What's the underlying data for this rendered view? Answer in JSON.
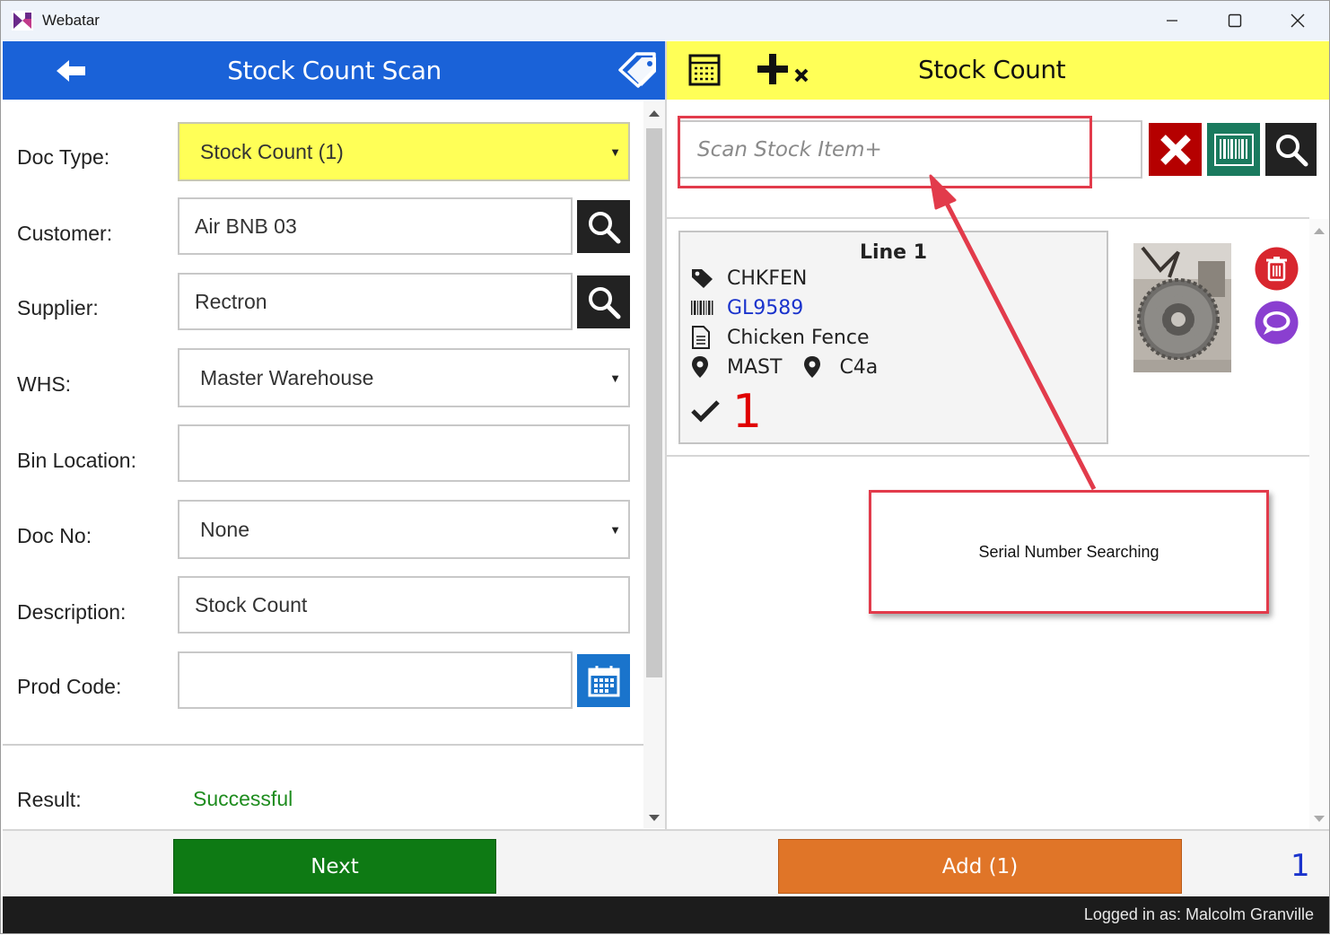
{
  "window": {
    "title": "Webatar"
  },
  "left": {
    "title": "Stock Count Scan",
    "form": {
      "doc_type": {
        "label": "Doc Type:",
        "value": "Stock Count (1)"
      },
      "customer": {
        "label": "Customer:",
        "value": "Air BNB 03"
      },
      "supplier": {
        "label": "Supplier:",
        "value": "Rectron"
      },
      "whs": {
        "label": "WHS:",
        "value": "Master Warehouse"
      },
      "bin_location": {
        "label": "Bin Location:",
        "value": ""
      },
      "doc_no": {
        "label": "Doc No:",
        "value": "None"
      },
      "description": {
        "label": "Description:",
        "value": "Stock Count"
      },
      "prod_code": {
        "label": "Prod Code:",
        "value": ""
      },
      "result": {
        "label": "Result:",
        "value": "Successful"
      }
    },
    "next_label": "Next"
  },
  "right": {
    "title": "Stock Count",
    "scan": {
      "placeholder": "Scan Stock Item+"
    },
    "line": {
      "title": "Line 1",
      "item_code": "CHKFEN",
      "barcode": "GL9589",
      "description": "Chicken Fence",
      "warehouse": "MAST",
      "bin": "C4a",
      "quantity": "1"
    },
    "add_label": "Add (1)",
    "count": "1"
  },
  "annotation": {
    "callout_text": "Serial Number Searching"
  },
  "status": {
    "logged_in": "Logged in as: Malcolm Granville"
  },
  "colors": {
    "header_blue": "#1a62d8",
    "header_yellow": "#ffff57",
    "next_green": "#0e7a14",
    "add_orange": "#e07528",
    "annotation_red": "#e23b4b"
  },
  "icons": [
    "back-arrow-icon",
    "tags-icon",
    "search-icon",
    "calendar-icon",
    "grid-icon",
    "plus-times-icon",
    "close-icon",
    "barcode-icon",
    "tag-icon",
    "document-icon",
    "location-icon",
    "checkmark-icon",
    "trash-icon",
    "chat-icon"
  ]
}
